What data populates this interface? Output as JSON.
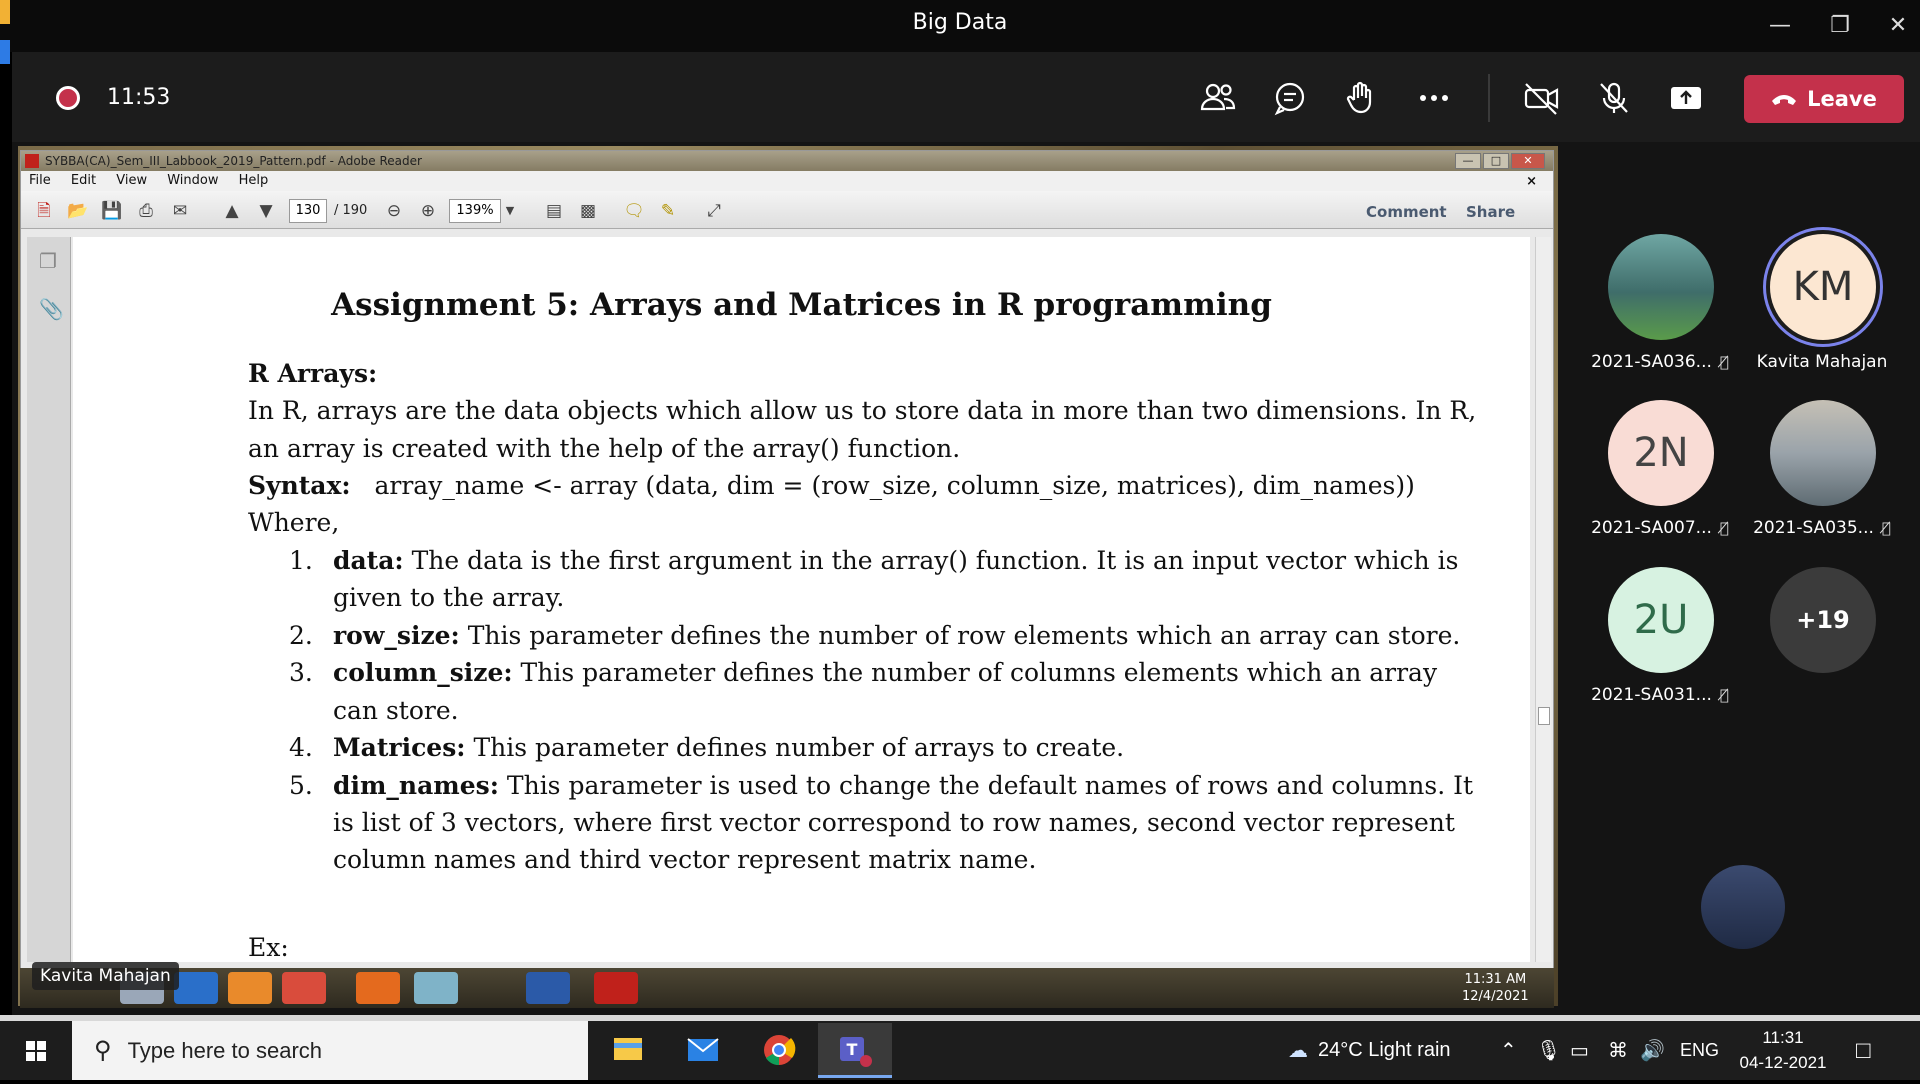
{
  "window": {
    "title": "Big Data"
  },
  "meeting": {
    "timer": "11:53",
    "leave_label": "Leave",
    "tools": [
      "people-icon",
      "chat-icon",
      "raise-hand-icon",
      "more-icon",
      "camera-off-icon",
      "mic-off-icon",
      "share-screen-icon"
    ]
  },
  "reader": {
    "window_title": "SYBBA(CA)_Sem_III_Labbook_2019_Pattern.pdf - Adobe Reader",
    "menu": [
      "File",
      "Edit",
      "View",
      "Window",
      "Help"
    ],
    "page_current": "130",
    "page_total": "/ 190",
    "zoom": "139%",
    "comment_label": "Comment",
    "share_label": "Share"
  },
  "document": {
    "heading": "Assignment 5: Arrays and Matrices in R programming",
    "section": "R Arrays:",
    "intro_1": "In R, arrays are the data objects which allow us to store data in more than two dimensions. In R,",
    "intro_2": "an array is created with the help of the array() function.",
    "syntax_label": "Syntax:",
    "syntax_code": "array_name <- array (data, dim = (row_size, column_size, matrices), dim_names))",
    "where": "Where,",
    "items": [
      {
        "num": "1.",
        "term": "data:",
        "text": " The data is the first argument in the array() function. It is an input vector which is",
        "cont": "given to the array."
      },
      {
        "num": "2.",
        "term": "row_size:",
        "text": " This parameter defines the number of row elements which an array can store.",
        "cont": ""
      },
      {
        "num": "3.",
        "term": "column_size:",
        "text": " This parameter defines the number of columns elements which an array",
        "cont": "can store."
      },
      {
        "num": "4.",
        "term": "Matrices:",
        "text": " This parameter defines number of arrays to create.",
        "cont": ""
      },
      {
        "num": "5.",
        "term": "dim_names:",
        "text": " This parameter is used to change the default names of rows and columns. It",
        "cont": "is list of 3 vectors, where first vector correspond to row names, second vector represent",
        "cont2": "column names and third vector represent matrix name."
      }
    ],
    "ex": "Ex:"
  },
  "inner_taskbar": {
    "time": "11:31 AM",
    "date": "12/4/2021"
  },
  "presenter_name": "Kavita Mahajan",
  "participants": [
    {
      "name": "2021-SA036...",
      "initials": "",
      "muted": true,
      "bg": "photo"
    },
    {
      "name": "Kavita Mahajan",
      "initials": "KM",
      "muted": false,
      "bg": "#fce7d2"
    },
    {
      "name": "2021-SA007...",
      "initials": "2N",
      "muted": true,
      "bg": "#f9dcd5"
    },
    {
      "name": "2021-SA035...",
      "initials": "",
      "muted": true,
      "bg": "photo"
    },
    {
      "name": "2021-SA031...",
      "initials": "2U",
      "muted": true,
      "bg": "#d7f2e1"
    },
    {
      "name": "",
      "initials": "+19",
      "muted": false,
      "bg": "#3b3b3b"
    }
  ],
  "taskbar": {
    "search_placeholder": "Type here to search",
    "weather": "24°C  Light rain",
    "lang": "ENG",
    "time": "11:31",
    "date": "04-12-2021"
  },
  "colors": {
    "leave": "#c4314b",
    "accent": "#7b83eb"
  }
}
